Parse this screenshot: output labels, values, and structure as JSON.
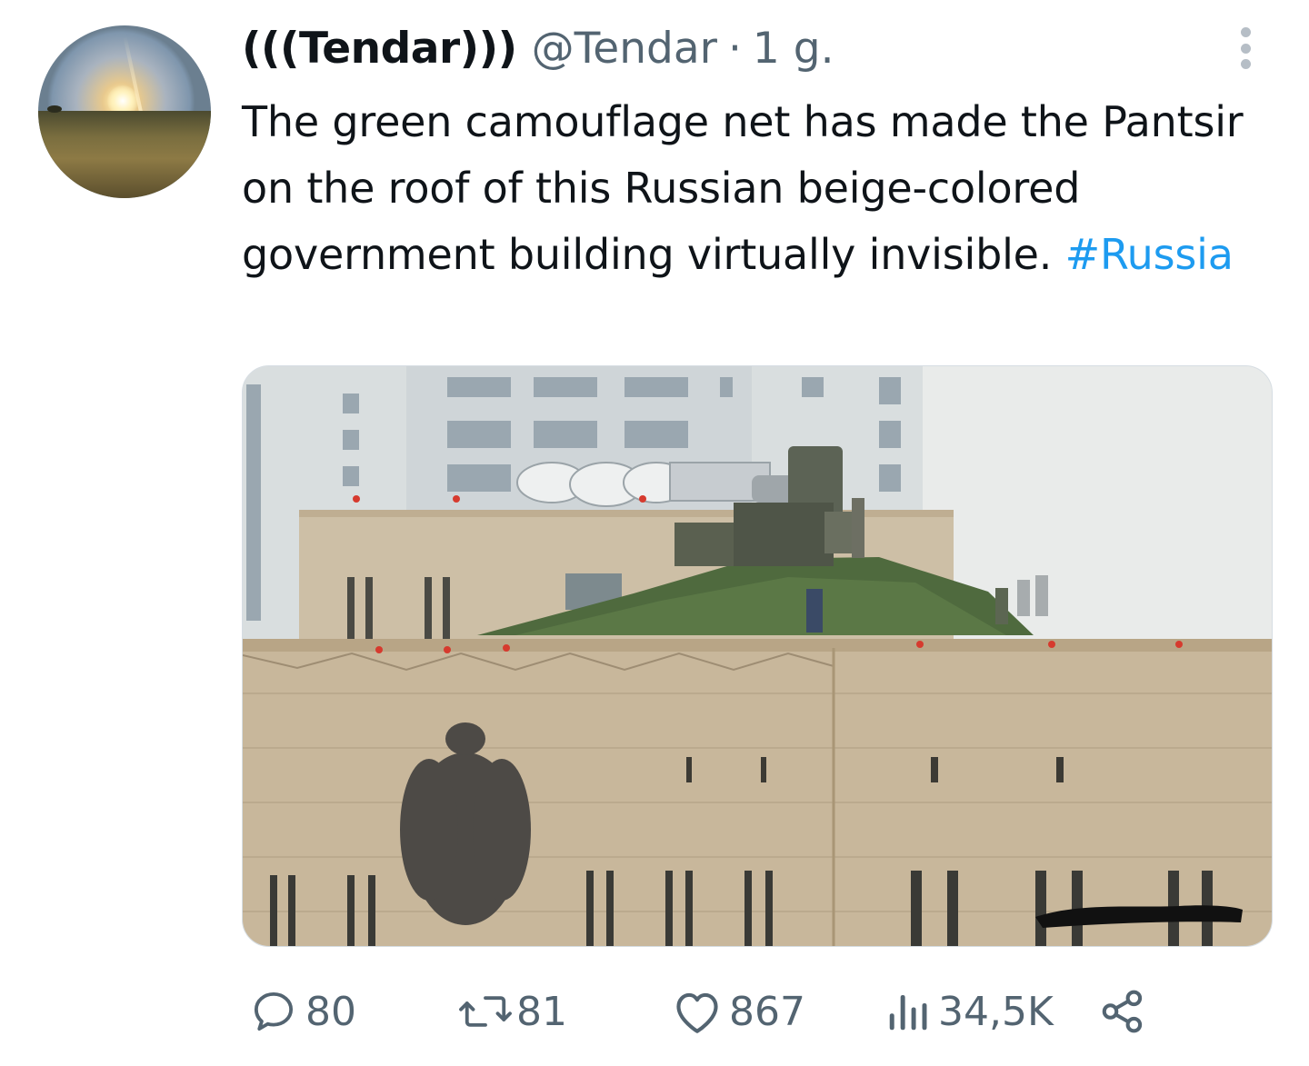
{
  "tweet": {
    "display_name": "(((Tendar)))",
    "handle": "@Tendar",
    "separator": "·",
    "time": "1 g.",
    "text_plain": "The green camouflage net has made the Pantsir on the roof of this Russian beige-colored government building virtually invisible.",
    "hashtag": "#Russia"
  },
  "actions": {
    "replies": "80",
    "retweets": "81",
    "likes": "867",
    "views": "34,5K"
  },
  "icons": [
    "more-icon",
    "reply-icon",
    "retweet-icon",
    "like-icon",
    "views-icon",
    "share-icon"
  ],
  "colors": {
    "text": "#0f1419",
    "secondary": "#536471",
    "link": "#1d9bf0"
  }
}
